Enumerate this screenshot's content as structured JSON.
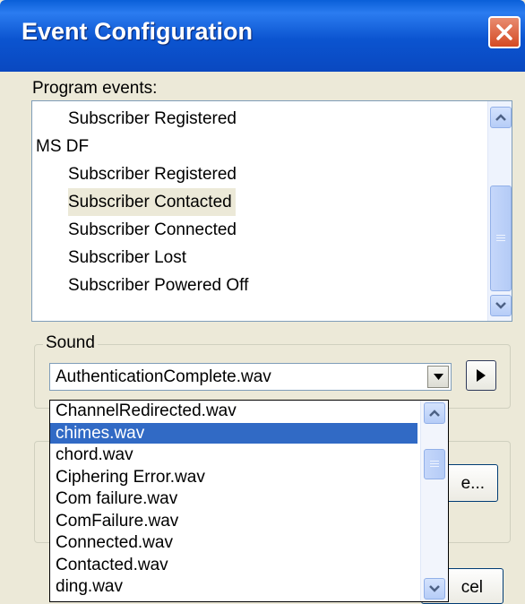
{
  "window": {
    "title": "Event Configuration"
  },
  "events": {
    "label": "Program events:",
    "items": [
      {
        "text": "Subscriber Registered",
        "indent": true,
        "selected": false
      },
      {
        "text": "MS DF",
        "indent": false,
        "selected": false
      },
      {
        "text": "Subscriber Registered",
        "indent": true,
        "selected": false
      },
      {
        "text": "Subscriber Contacted",
        "indent": true,
        "selected": true
      },
      {
        "text": "Subscriber Connected",
        "indent": true,
        "selected": false
      },
      {
        "text": "Subscriber Lost",
        "indent": true,
        "selected": false
      },
      {
        "text": "Subscriber Powered Off",
        "indent": true,
        "selected": false
      }
    ]
  },
  "sound": {
    "group_label": "Sound",
    "selected_value": "AuthenticationComplete.wav",
    "options": [
      "ChannelRedirected.wav",
      "chimes.wav",
      "chord.wav",
      "Ciphering Error.wav",
      "Com failure.wav",
      "ComFailure.wav",
      "Connected.wav",
      "Contacted.wav",
      "ding.wav"
    ],
    "highlighted_option": "chimes.wav"
  },
  "partial_buttons": {
    "browse_fragment": "e...",
    "cancel_fragment": "cel"
  },
  "icons": {
    "close": "close-icon",
    "scroll_up": "arrow-up-icon",
    "scroll_down": "arrow-down-icon",
    "dropdown": "chevron-down-icon",
    "play": "play-icon"
  },
  "colors": {
    "titlebar": "#0a54d0",
    "selection_bg": "#316ac5",
    "focus_row_bg": "#ece9d8"
  }
}
